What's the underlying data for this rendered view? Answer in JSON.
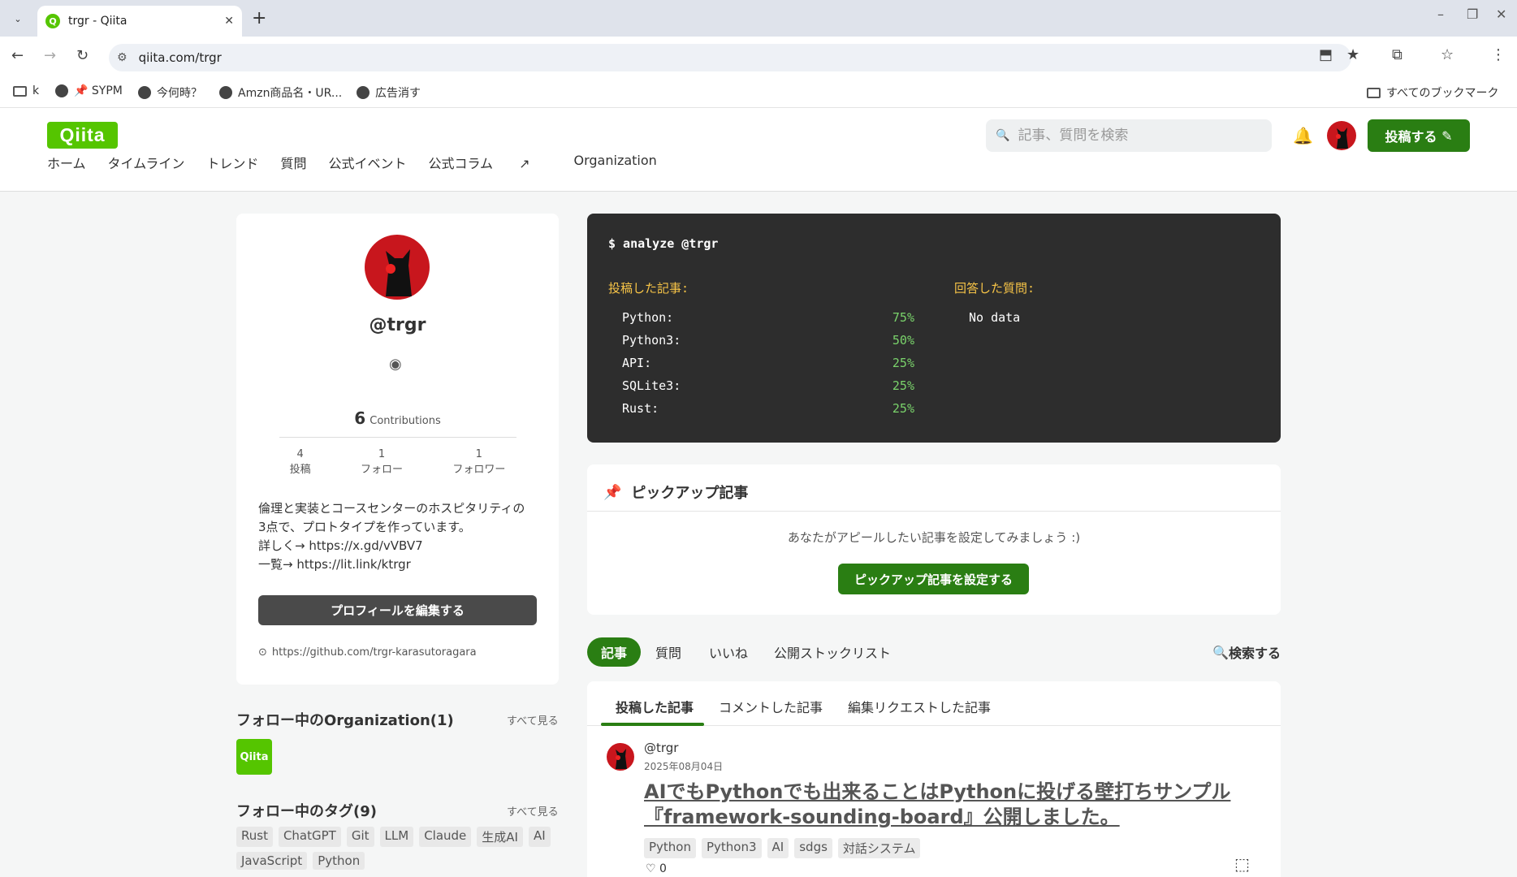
{
  "browser": {
    "tab_title": "trgr - Qiita",
    "tab_close": "✕",
    "new_tab": "+",
    "url": "qiita.com/trgr",
    "bookmarks": [
      {
        "label": "k"
      },
      {
        "label": "📌 SYPM"
      },
      {
        "label": "今何時？"
      },
      {
        "label": "Amzn商品名・UR..."
      },
      {
        "label": "広告消す"
      }
    ],
    "all_bookmarks": "すべてのブックマーク"
  },
  "header": {
    "logo": "Qiita",
    "search_placeholder": "記事、質問を検索",
    "post_button": "投稿する",
    "nav": [
      "ホーム",
      "タイムライン",
      "トレンド",
      "質問",
      "公式イベント",
      "公式コラム",
      "Organization"
    ]
  },
  "profile": {
    "username": "@trgr",
    "contributions_count": "6",
    "contributions_label": "Contributions",
    "stats": [
      {
        "value": "4",
        "label": "投稿"
      },
      {
        "value": "1",
        "label": "フォロー"
      },
      {
        "value": "1",
        "label": "フォロワー"
      }
    ],
    "bio": [
      "倫理と実装とコースセンターのホスピタリティの",
      "3点で、プロトタイプを作っています。",
      "詳しく→ https://x.gd/vVBV7",
      "一覧→ https://lit.link/ktrgr"
    ],
    "edit_button": "プロフィールを編集する",
    "github": "https://github.com/trgr-karasutoragara"
  },
  "orgs": {
    "title": "フォロー中のOrganization(1)",
    "more": "すべて見る",
    "logo": "Qiita"
  },
  "followed_tags": {
    "title": "フォロー中のタグ(9)",
    "more": "すべて見る",
    "tags": [
      "Rust",
      "ChatGPT",
      "Git",
      "LLM",
      "Claude",
      "生成AI",
      "AI",
      "JavaScript",
      "Python"
    ]
  },
  "analyze": {
    "command": "$ analyze @trgr",
    "posted_heading": "投稿した記事:",
    "answered_heading": "回答した質問:",
    "rows": [
      {
        "name": "Python:",
        "pct": "75%"
      },
      {
        "name": "Python3:",
        "pct": "50%"
      },
      {
        "name": "API:",
        "pct": "25%"
      },
      {
        "name": "SQLite3:",
        "pct": "25%"
      },
      {
        "name": "Rust:",
        "pct": "25%"
      }
    ],
    "no_data": "No data"
  },
  "pickup": {
    "title": "ピックアップ記事",
    "message": "あなたがアピールしたい記事を設定してみましょう :)",
    "button": "ピックアップ記事を設定する"
  },
  "content_tabs": {
    "tabs": [
      "記事",
      "質問",
      "いいね",
      "公開ストックリスト"
    ],
    "search": "検索する"
  },
  "article_list": {
    "subtabs": [
      "投稿した記事",
      "コメントした記事",
      "編集リクエストした記事"
    ],
    "items": [
      {
        "user": "@trgr",
        "date": "2025年08月04日",
        "title": "AIでもPythonでも出来ることはPythonに投げる壁打ちサンプル『framework-sounding-board』公開しました。",
        "tags": [
          "Python",
          "Python3",
          "AI",
          "sdgs",
          "対話システム"
        ],
        "likes": "0"
      }
    ]
  }
}
